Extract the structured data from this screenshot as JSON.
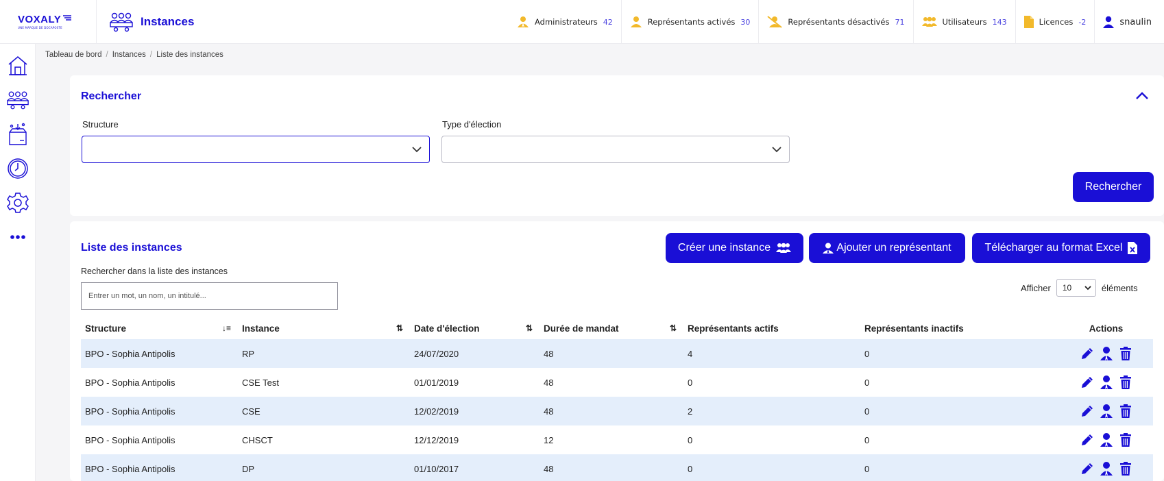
{
  "brand": {
    "name": "VOXALY",
    "tagline": "UNE MARQUE DE DOCAPOSTE"
  },
  "header": {
    "title": "Instances",
    "stats": [
      {
        "label": "Administrateurs",
        "count": "42",
        "icon": "user-icon"
      },
      {
        "label": "Représentants activés",
        "count": "30",
        "icon": "user-icon"
      },
      {
        "label": "Représentants désactivés",
        "count": "71",
        "icon": "user-slash-icon"
      },
      {
        "label": "Utilisateurs",
        "count": "143",
        "icon": "users-icon"
      },
      {
        "label": "Licences",
        "count": "-2",
        "icon": "file-icon"
      }
    ],
    "user": "snaulin"
  },
  "sidebar": [
    {
      "icon": "home-icon"
    },
    {
      "icon": "instances-icon"
    },
    {
      "icon": "ballot-box-icon"
    },
    {
      "icon": "clock-icon"
    },
    {
      "icon": "gear-icon"
    },
    {
      "icon": "more-icon"
    }
  ],
  "breadcrumb": [
    "Tableau de bord",
    "Instances",
    "Liste des instances"
  ],
  "search": {
    "title": "Rechercher",
    "structure_label": "Structure",
    "structure_value": "",
    "election_label": "Type d'élection",
    "election_value": "",
    "button": "Rechercher"
  },
  "list": {
    "title": "Liste des instances",
    "create_button": "Créer une instance",
    "add_rep_button": "Ajouter un représentant",
    "excel_button": "Télécharger au format Excel",
    "search_label": "Rechercher dans la liste des instances",
    "search_placeholder": "Entrer un mot, un nom, un intitulé...",
    "show_label": "Afficher",
    "show_value": "10",
    "show_suffix": "éléments",
    "columns": [
      "Structure",
      "Instance",
      "Date d'élection",
      "Durée de mandat",
      "Représentants actifs",
      "Représentants inactifs",
      "Actions"
    ],
    "rows": [
      [
        "BPO - Sophia Antipolis",
        "RP",
        "24/07/2020",
        "48",
        "4",
        "0"
      ],
      [
        "BPO - Sophia Antipolis",
        "CSE Test",
        "01/01/2019",
        "48",
        "0",
        "0"
      ],
      [
        "BPO - Sophia Antipolis",
        "CSE",
        "12/02/2019",
        "48",
        "2",
        "0"
      ],
      [
        "BPO - Sophia Antipolis",
        "CHSCT",
        "12/12/2019",
        "12",
        "0",
        "0"
      ],
      [
        "BPO - Sophia Antipolis",
        "DP",
        "01/10/2017",
        "48",
        "0",
        "0"
      ]
    ]
  },
  "colors": {
    "primary": "#1a0fd6",
    "accent_yellow": "#f2b92b",
    "row_stripe": "#e4eefb"
  }
}
